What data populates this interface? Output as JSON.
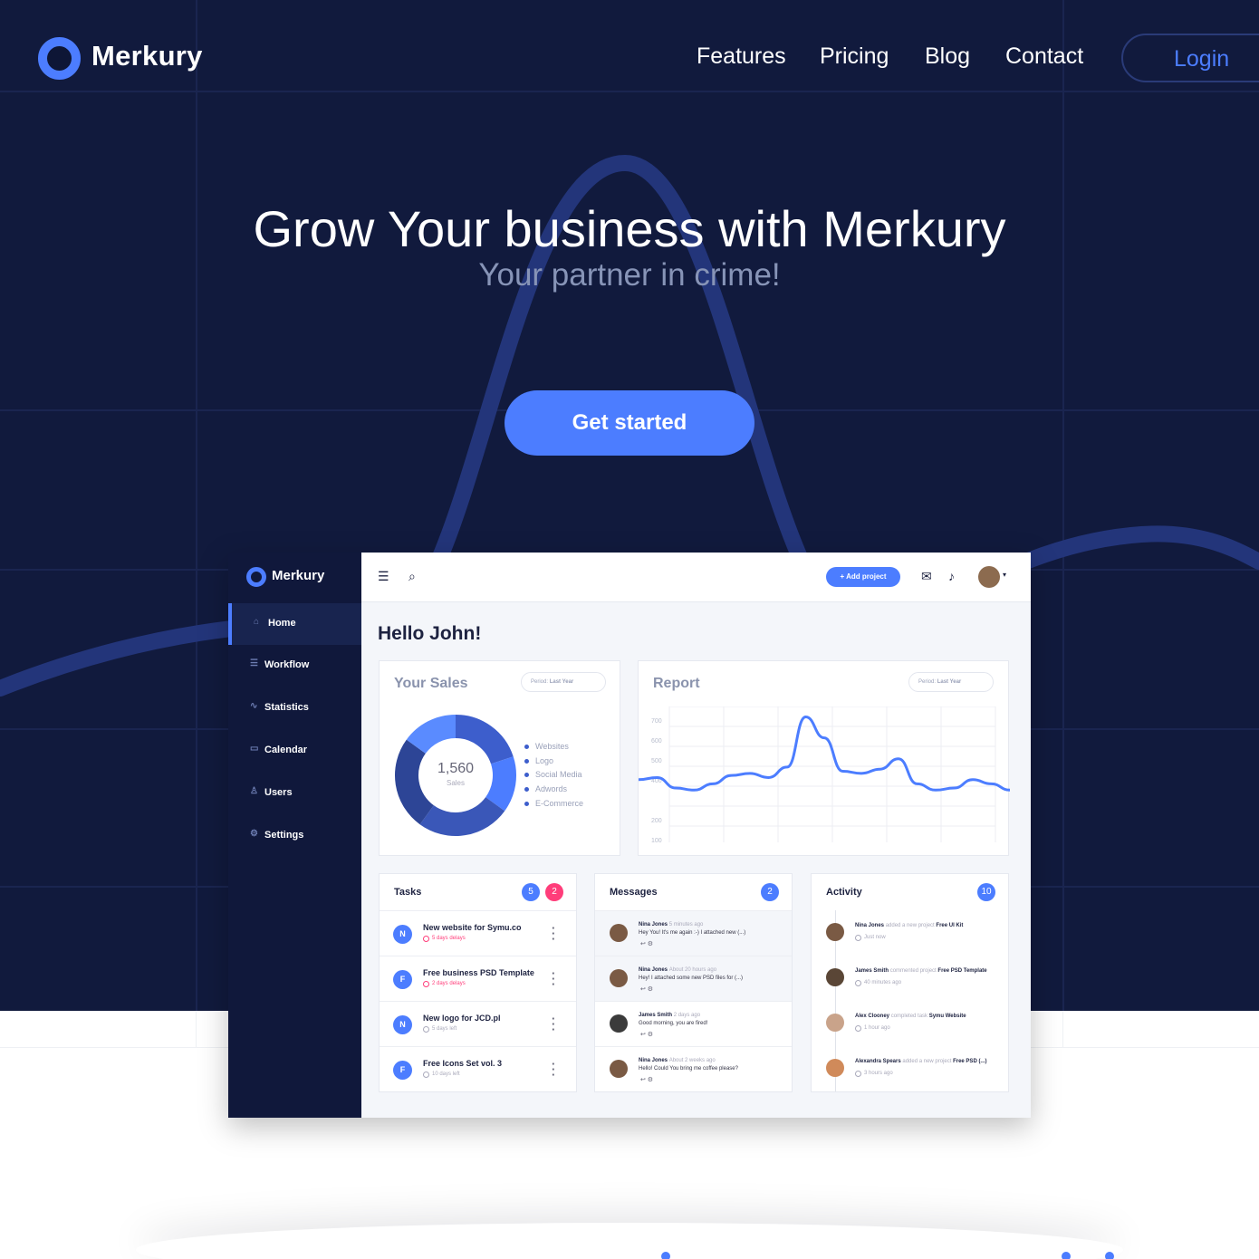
{
  "colors": {
    "hero_bg": "#111a3d",
    "accent": "#4c7dff",
    "pink": "#ff3d7a",
    "sidebar": "#10183b"
  },
  "nav": {
    "brand": "Merkury",
    "links": [
      "Features",
      "Pricing",
      "Blog",
      "Contact"
    ],
    "login": "Login"
  },
  "hero": {
    "title": "Grow Your business with Merkury",
    "subtitle": "Your partner in crime!",
    "cta": "Get started"
  },
  "dashboard": {
    "brand": "Merkury",
    "sidebar": [
      {
        "label": "Home",
        "icon": "home-icon"
      },
      {
        "label": "Workflow",
        "icon": "workflow-icon"
      },
      {
        "label": "Statistics",
        "icon": "statistics-icon"
      },
      {
        "label": "Calendar",
        "icon": "calendar-icon"
      },
      {
        "label": "Users",
        "icon": "users-icon"
      },
      {
        "label": "Settings",
        "icon": "settings-icon"
      }
    ],
    "add_project": "+ Add project",
    "greeting": "Hello John!",
    "sales": {
      "title": "Your Sales",
      "period_label": "Period:",
      "period_value": "Last Year",
      "total": "1,560",
      "total_label": "Sales",
      "legend": [
        "Websites",
        "Logo",
        "Social Media",
        "Adwords",
        "E-Commerce"
      ]
    },
    "report": {
      "title": "Report",
      "period_label": "Period:",
      "period_value": "Last Year",
      "y_ticks": [
        "700",
        "600",
        "500",
        "400",
        "200",
        "100"
      ]
    },
    "tasks": {
      "title": "Tasks",
      "badge_a": "5",
      "badge_b": "2",
      "items": [
        {
          "initial": "N",
          "title": "New website for Symu.co",
          "meta": "5 days delays",
          "late": true
        },
        {
          "initial": "F",
          "title": "Free business PSD Template",
          "meta": "2 days delays",
          "late": true
        },
        {
          "initial": "N",
          "title": "New logo for JCD.pl",
          "meta": "5 days left",
          "late": false
        },
        {
          "initial": "F",
          "title": "Free Icons Set vol. 3",
          "meta": "10 days left",
          "late": false
        }
      ]
    },
    "messages": {
      "title": "Messages",
      "badge": "2",
      "items": [
        {
          "name": "Nina Jones",
          "time": "5 minutes ago",
          "text": "Hey You! It's me again :-) I attached new (...)"
        },
        {
          "name": "Nina Jones",
          "time": "About 20 hours ago",
          "text": "Hey! I attached some new PSD files for (...)"
        },
        {
          "name": "James Smith",
          "time": "2 days ago",
          "text": "Good morning, you are fired!"
        },
        {
          "name": "Nina Jones",
          "time": "About 2 weeks ago",
          "text": "Hello! Could You bring me coffee please?"
        }
      ]
    },
    "activity": {
      "title": "Activity",
      "badge": "10",
      "items": [
        {
          "name": "Nina Jones",
          "action": "added a new project",
          "target": "Free UI Kit",
          "time": "Just now"
        },
        {
          "name": "James Smith",
          "action": "commented project",
          "target": "Free PSD Template",
          "time": "40 minutes ago"
        },
        {
          "name": "Alex Clooney",
          "action": "completed task",
          "target": "Symu Website",
          "time": "1 hour ago"
        },
        {
          "name": "Alexandra Spears",
          "action": "added a new project",
          "target": "Free PSD (...)",
          "time": "3 hours ago"
        }
      ]
    }
  },
  "chart_data": [
    {
      "type": "pie",
      "title": "Your Sales",
      "categories": [
        "Websites",
        "Logo",
        "Social Media",
        "Adwords",
        "E-Commerce"
      ],
      "values": [
        20,
        15,
        25,
        25,
        15
      ]
    },
    {
      "type": "line",
      "title": "Report",
      "y_ticks": [
        100,
        200,
        400,
        500,
        600,
        700
      ],
      "x": [
        0,
        1,
        2,
        3,
        4,
        5,
        6,
        7,
        8,
        9,
        10,
        11,
        12,
        13,
        14,
        15,
        16,
        17,
        18,
        19,
        20
      ],
      "values": [
        400,
        410,
        360,
        350,
        380,
        420,
        430,
        410,
        460,
        700,
        600,
        440,
        430,
        450,
        500,
        380,
        350,
        360,
        400,
        380,
        350
      ]
    }
  ]
}
